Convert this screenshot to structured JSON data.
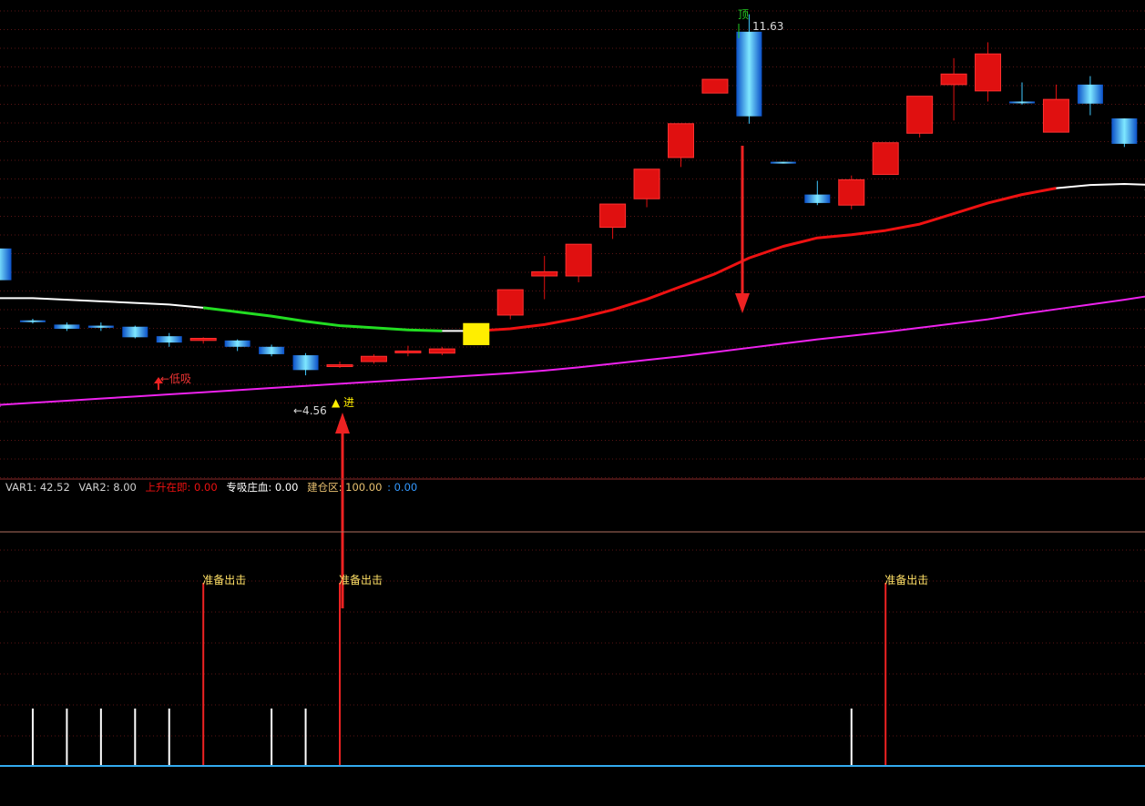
{
  "chart_data": [
    {
      "type": "candlestick",
      "pane": "main",
      "y_range": [
        3.2,
        11.9
      ],
      "candles": [
        {
          "o": 7.2,
          "c": 6.6,
          "h": 7.3,
          "l": 6.4,
          "color": "#18a8ff"
        },
        {
          "o": 5.84,
          "c": 5.82,
          "h": 5.87,
          "l": 5.78,
          "color": "#18a8ff"
        },
        {
          "o": 5.76,
          "c": 5.68,
          "h": 5.8,
          "l": 5.64,
          "color": "#18a8ff"
        },
        {
          "o": 5.74,
          "c": 5.7,
          "h": 5.8,
          "l": 5.64,
          "color": "#18a8ff"
        },
        {
          "o": 5.72,
          "c": 5.52,
          "h": 5.74,
          "l": 5.5,
          "color": "#18a8ff"
        },
        {
          "o": 5.54,
          "c": 5.42,
          "h": 5.6,
          "l": 5.34,
          "color": "#18a8ff"
        },
        {
          "o": 5.46,
          "c": 5.5,
          "h": 5.52,
          "l": 5.4,
          "color": "#e01010"
        },
        {
          "o": 5.46,
          "c": 5.34,
          "h": 5.48,
          "l": 5.26,
          "color": "#18a8ff"
        },
        {
          "o": 5.34,
          "c": 5.2,
          "h": 5.38,
          "l": 5.16,
          "color": "#18a8ff"
        },
        {
          "o": 5.18,
          "c": 4.9,
          "h": 5.22,
          "l": 4.8,
          "color": "#18a8ff"
        },
        {
          "o": 4.98,
          "c": 5.0,
          "h": 5.06,
          "l": 4.94,
          "color": "#e01010"
        },
        {
          "o": 5.06,
          "c": 5.16,
          "h": 5.2,
          "l": 5.02,
          "color": "#e01010"
        },
        {
          "o": 5.24,
          "c": 5.26,
          "h": 5.36,
          "l": 5.16,
          "color": "#e01010"
        },
        {
          "o": 5.22,
          "c": 5.3,
          "h": 5.34,
          "l": 5.18,
          "color": "#e01010"
        },
        {
          "o": 5.38,
          "c": 5.78,
          "h": 5.78,
          "l": 5.38,
          "color": "#ffee00"
        },
        {
          "o": 5.94,
          "c": 6.42,
          "h": 6.42,
          "l": 5.86,
          "color": "#e01010"
        },
        {
          "o": 6.68,
          "c": 6.76,
          "h": 7.06,
          "l": 6.24,
          "color": "#e01010"
        },
        {
          "o": 6.68,
          "c": 7.28,
          "h": 7.28,
          "l": 6.56,
          "color": "#e01010"
        },
        {
          "o": 7.6,
          "c": 8.04,
          "h": 8.04,
          "l": 7.38,
          "color": "#e01010"
        },
        {
          "o": 8.14,
          "c": 8.7,
          "h": 8.7,
          "l": 7.98,
          "color": "#e01010"
        },
        {
          "o": 8.92,
          "c": 9.56,
          "h": 9.56,
          "l": 8.74,
          "color": "#e01010"
        },
        {
          "o": 10.14,
          "c": 10.4,
          "h": 10.4,
          "l": 10.14,
          "color": "#e01010"
        },
        {
          "o": 11.3,
          "c": 9.7,
          "h": 11.63,
          "l": 9.56,
          "color": "#18a8ff"
        },
        {
          "o": 8.84,
          "c": 8.84,
          "h": 8.84,
          "l": 8.84,
          "color": "#18a8ff"
        },
        {
          "o": 8.22,
          "c": 8.06,
          "h": 8.48,
          "l": 8.02,
          "color": "#18a8ff"
        },
        {
          "o": 8.02,
          "c": 8.5,
          "h": 8.58,
          "l": 7.94,
          "color": "#e01010"
        },
        {
          "o": 8.6,
          "c": 9.2,
          "h": 9.2,
          "l": 8.6,
          "color": "#e01010"
        },
        {
          "o": 9.38,
          "c": 10.08,
          "h": 10.08,
          "l": 9.3,
          "color": "#e01010"
        },
        {
          "o": 10.3,
          "c": 10.5,
          "h": 10.8,
          "l": 9.62,
          "color": "#e01010"
        },
        {
          "o": 10.18,
          "c": 10.88,
          "h": 11.1,
          "l": 9.98,
          "color": "#e01010"
        },
        {
          "o": 9.96,
          "c": 9.98,
          "h": 10.34,
          "l": 9.92,
          "color": "#18a8ff"
        },
        {
          "o": 9.4,
          "c": 10.02,
          "h": 10.3,
          "l": 9.4,
          "color": "#e01010"
        },
        {
          "o": 10.3,
          "c": 9.94,
          "h": 10.46,
          "l": 9.72,
          "color": "#18a8ff"
        },
        {
          "o": 9.66,
          "c": 9.18,
          "h": 9.66,
          "l": 9.12,
          "color": "#18a8ff"
        },
        {
          "o": 9.1,
          "c": 8.9,
          "h": 9.14,
          "l": 8.8,
          "color": "#18a8ff"
        }
      ],
      "moving_averages": [
        {
          "values": [
            null,
            6.26,
            6.23,
            6.2,
            6.17,
            6.14,
            6.08,
            6.0,
            5.92,
            5.82,
            5.74,
            5.7,
            5.66,
            5.64,
            5.64,
            5.68,
            5.76,
            5.88,
            6.04,
            6.24,
            6.48,
            6.72,
            7.02,
            7.24,
            7.4,
            7.46,
            7.54,
            7.66,
            7.86,
            8.06,
            8.22,
            8.34,
            8.4,
            8.42,
            8.4
          ],
          "segment_colors": [
            {
              "from": 0,
              "to": 6,
              "color": "#ffffff"
            },
            {
              "from": 6,
              "to": 13,
              "color": "#22dd22"
            },
            {
              "from": 13,
              "to": 14,
              "color": "#ffffff"
            },
            {
              "from": 14,
              "to": 31,
              "color": "#ee1111"
            },
            {
              "from": 31,
              "to": 34,
              "color": "#ffffff"
            }
          ]
        },
        {
          "values": [
            4.24,
            4.28,
            4.32,
            4.36,
            4.4,
            4.44,
            4.48,
            4.52,
            4.56,
            4.6,
            4.64,
            4.68,
            4.72,
            4.76,
            4.8,
            4.84,
            4.89,
            4.95,
            5.02,
            5.09,
            5.16,
            5.24,
            5.32,
            5.4,
            5.48,
            5.55,
            5.62,
            5.7,
            5.78,
            5.86,
            5.96,
            6.05,
            6.14,
            6.23,
            6.33
          ],
          "color": "#ee22ee"
        }
      ],
      "annotations": {
        "high_label": "11.63",
        "high_marker": "顶",
        "low_label": "←4.56",
        "buy_signal": "▲ 进",
        "absorb_label": "←低吸"
      }
    },
    {
      "type": "indicator",
      "pane": "sub",
      "legend": [
        {
          "text": "VAR1: 42.52",
          "color": "#d0d0d0"
        },
        {
          "text": "VAR2: 8.00",
          "color": "#d0d0d0"
        },
        {
          "text": "上升在即: 0.00",
          "color": "#ee1111"
        },
        {
          "text": "专吸庄血: 0.00",
          "color": "#ffffff"
        },
        {
          "text": "建仓区: 100.00",
          "color": "#e8c070"
        },
        {
          "text": ": 0.00",
          "color": "#3399ff"
        }
      ],
      "white_bars": [
        1,
        2,
        3,
        4,
        5,
        8,
        9,
        25
      ],
      "red_signals": [
        {
          "index": 6,
          "label": "准备出击"
        },
        {
          "index": 10,
          "label": "准备出击"
        },
        {
          "index": 26,
          "label": "准备出击"
        }
      ]
    }
  ]
}
